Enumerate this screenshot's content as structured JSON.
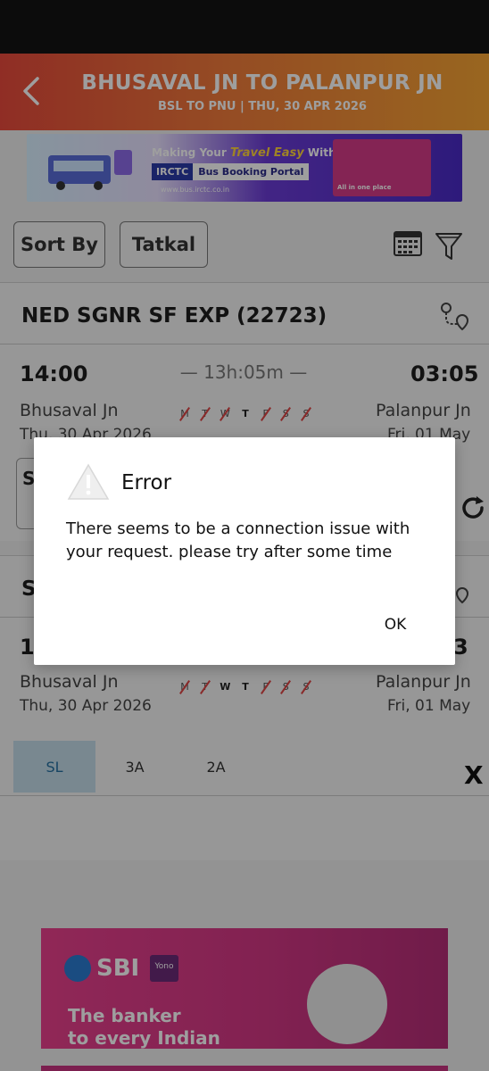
{
  "header": {
    "title": "BHUSAVAL JN TO PALANPUR JN",
    "subtitle": "BSL TO PNU | THU, 30 APR 2026"
  },
  "banner": {
    "line1_prefix": "Making Your",
    "line1_highlight": "Travel Easy",
    "line1_suffix": "With",
    "irctc": "IRCTC",
    "portal": "Bus Booking Portal",
    "url": "www.bus.irctc.co.in",
    "box_text": "All in one place"
  },
  "controls": {
    "sort_label": "Sort By",
    "quota_label": "Tatkal"
  },
  "trains": [
    {
      "name": "NED SGNR SF EXP (22723)",
      "dep_time": "14:00",
      "arr_time": "03:05",
      "duration": "13h:05m",
      "from_station": "Bhusaval Jn",
      "to_station": "Palanpur Jn",
      "dep_date": "Thu, 30 Apr  2026",
      "arr_date": "Fri, 01 May",
      "partial_class": "S"
    },
    {
      "name_partial": "S",
      "dep_time_partial": "1",
      "arr_time_partial": "3",
      "from_station": "Bhusaval Jn",
      "to_station": "Palanpur Jn",
      "dep_date": "Thu, 30 Apr  2026",
      "arr_date": "Fri, 01 May",
      "classes": [
        "SL",
        "3A",
        "2A"
      ],
      "close_label": "X"
    }
  ],
  "days": [
    "M",
    "T",
    "W",
    "T",
    "F",
    "S",
    "S"
  ],
  "ad": {
    "brand": "SBI",
    "yono": "Yono",
    "tagline_1": "The banker",
    "tagline_2": "to every Indian"
  },
  "dialog": {
    "title": "Error",
    "message": "There seems to be a connection issue with your request. please try after some time",
    "ok_label": "OK"
  }
}
